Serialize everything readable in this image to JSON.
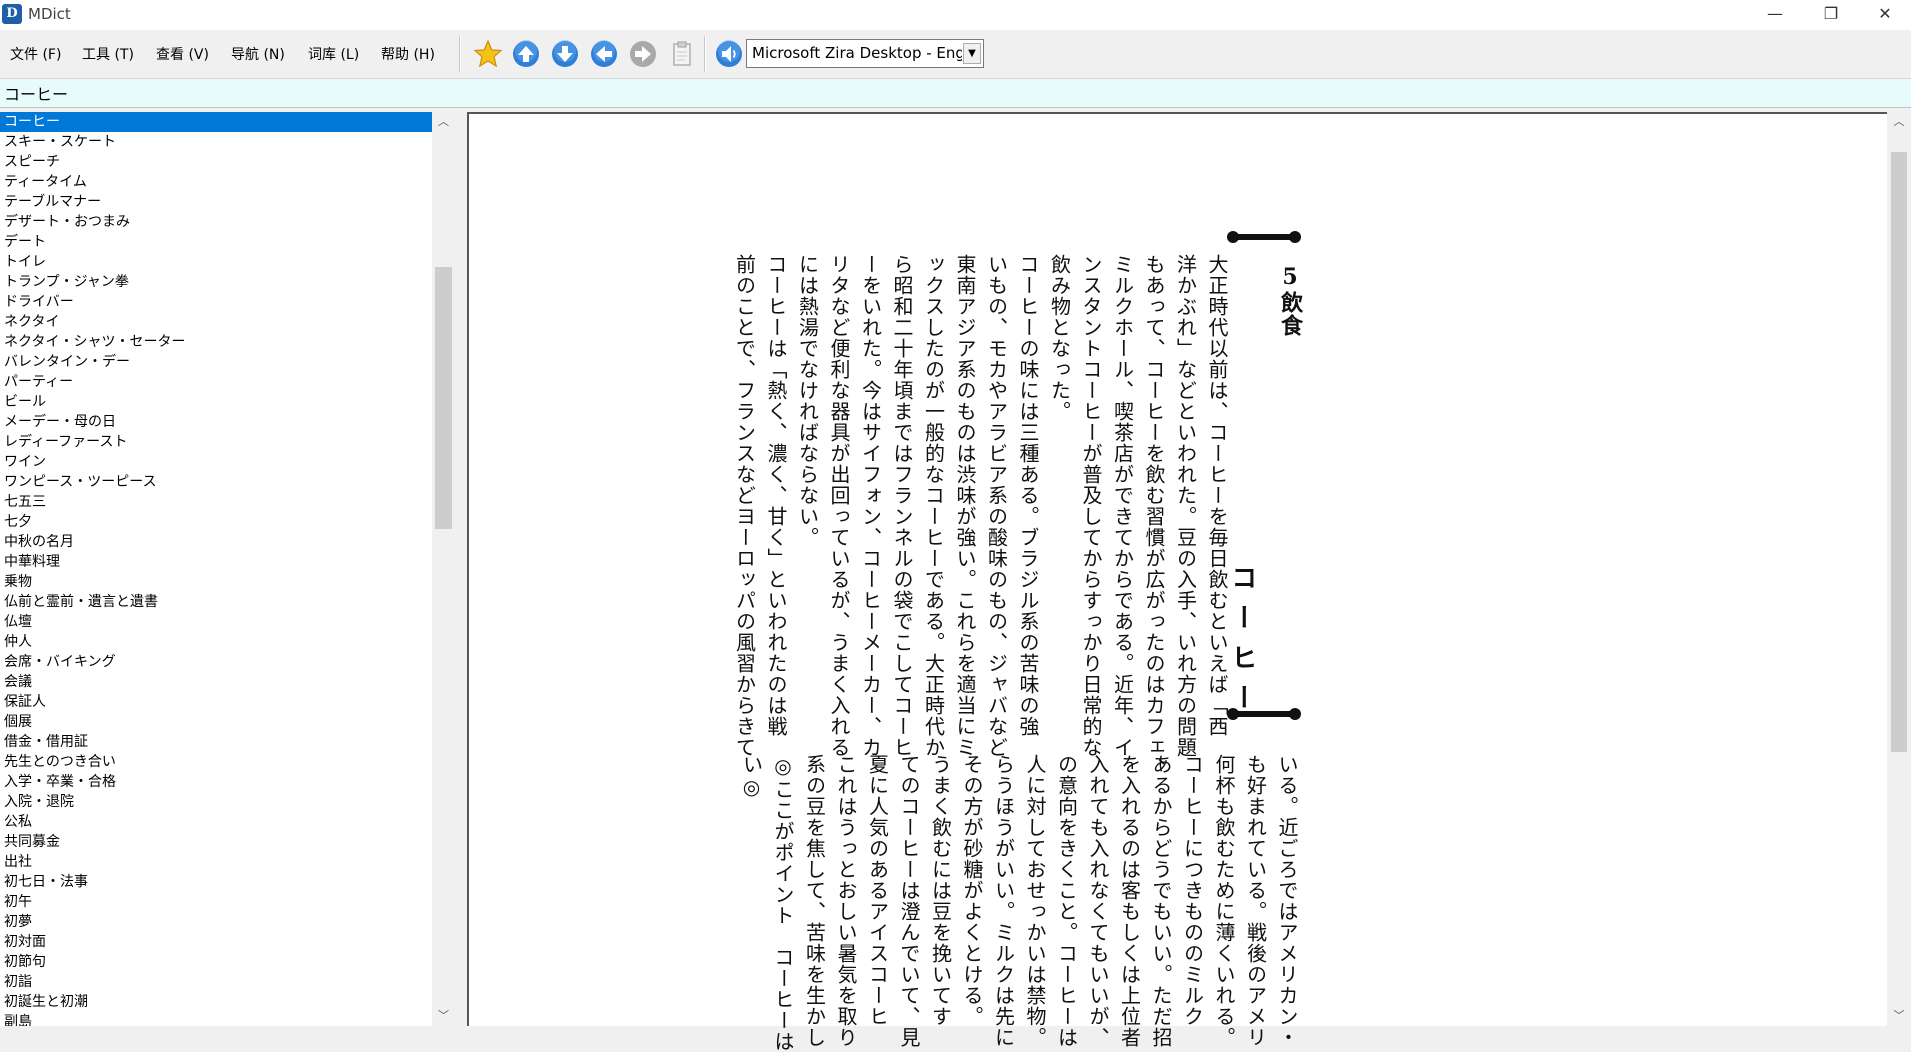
{
  "window": {
    "title": "MDict",
    "minimize_glyph": "—",
    "restore_glyph": "❐",
    "close_glyph": "✕"
  },
  "menu": [
    {
      "label": "文件 (F)"
    },
    {
      "label": "工具 (T)"
    },
    {
      "label": "查看 (V)"
    },
    {
      "label": "导航 (N)"
    },
    {
      "label": "词库 (L)"
    },
    {
      "label": "帮助 (H)"
    }
  ],
  "toolbar": {
    "icons": [
      "star-icon",
      "arrow-up-icon",
      "arrow-down-icon",
      "arrow-left-icon",
      "arrow-right-icon",
      "clipboard-icon",
      "speaker-icon"
    ],
    "voice_selected": "Microsoft Zira Desktop - English",
    "dropdown_glyph": "▼",
    "accent_color": "#2f7fd6"
  },
  "search": {
    "value": "コーヒー"
  },
  "wordlist": {
    "selected_index": 0,
    "items": [
      "コーヒー",
      "スキー・スケート",
      "スピーチ",
      "ティータイム",
      "テーブルマナー",
      "デザート・おつまみ",
      "デート",
      "トイレ",
      "トランプ・ジャン拳",
      "ドライバー",
      "ネクタイ",
      "ネクタイ・シャツ・セーター",
      "バレンタイン・デー",
      "パーティー",
      "ビール",
      "メーデー・母の日",
      "レディーファースト",
      "ワイン",
      "ワンピース・ツーピース",
      "七五三",
      "七夕",
      "中秋の名月",
      "中華料理",
      "乗物",
      "仏前と霊前・遺言と遺書",
      "仏壇",
      "仲人",
      "会席・バイキング",
      "会議",
      "保証人",
      "個展",
      "借金・借用証",
      "先生とのつき合い",
      "入学・卒業・合格",
      "入院・退院",
      "公私",
      "共同募金",
      "出社",
      "初七日・法事",
      "初午",
      "初夢",
      "初対面",
      "初節句",
      "初詣",
      "初誕生と初潮",
      "副島"
    ]
  },
  "scroll": {
    "up_glyph": "︿",
    "down_glyph": "﹀"
  },
  "page": {
    "section_label": "5飲食",
    "heading": "コーヒー",
    "upper_columns": [
      "大正時代以前は、コーヒーを毎日飲むといえば「西",
      "洋かぶれ」などといわれた。豆の入手、いれ方の問題",
      "もあって、コーヒーを飲む習慣が広がったのはカフェ、",
      "ミルクホール、喫茶店ができてからである。近年、イ",
      "ンスタントコーヒーが普及してからすっかり日常的な",
      "飲み物となった。",
      "コーヒーの味には三種ある。ブラジル系の苦味の強",
      "いもの、モカやアラビア系の酸味のもの、ジャバなど",
      "東南アジア系のものは渋味が強い。これらを適当にミ",
      "ックスしたのが一般的なコーヒーである。大正時代か",
      "ら昭和二十年頃まではフランネルの袋でこしてコーヒ",
      "ーをいれた。今はサイフォン、コーヒーメーカー、カ",
      "リタなど便利な器具が出回っているが、うまく入れる",
      "には熱湯でなければならない。",
      "コーヒーは「熱く、濃く、甘く」といわれたのは戦",
      "前のことで、フランスなどヨーロッパの風習からきて"
    ],
    "lower_columns": [
      "いる。近ごろではアメリカン・",
      "も好まれている。戦後のアメリ",
      "何杯も飲むために薄くいれる。",
      "コーヒーにつきもののミルク",
      "あるからどうでもいい。ただ招",
      "を入れるのは客もしくは上位者",
      "入れても入れなくてもいいが、",
      "の意向をきくこと。コーヒーは",
      "人に対しておせっかいは禁物。",
      "らうほうがいい。ミルクは先に",
      "その方が砂糖がよくとける。",
      "うまく飲むには豆を挽いてす",
      "てのコーヒーは澄んでいて、見",
      "夏に人気のあるアイスコーヒ",
      "これはうっとおしい暑気を取り",
      "系の豆を焦して、苦味を生かし",
      "◎ここがポイント　コーヒーは",
      "い◎"
    ]
  }
}
